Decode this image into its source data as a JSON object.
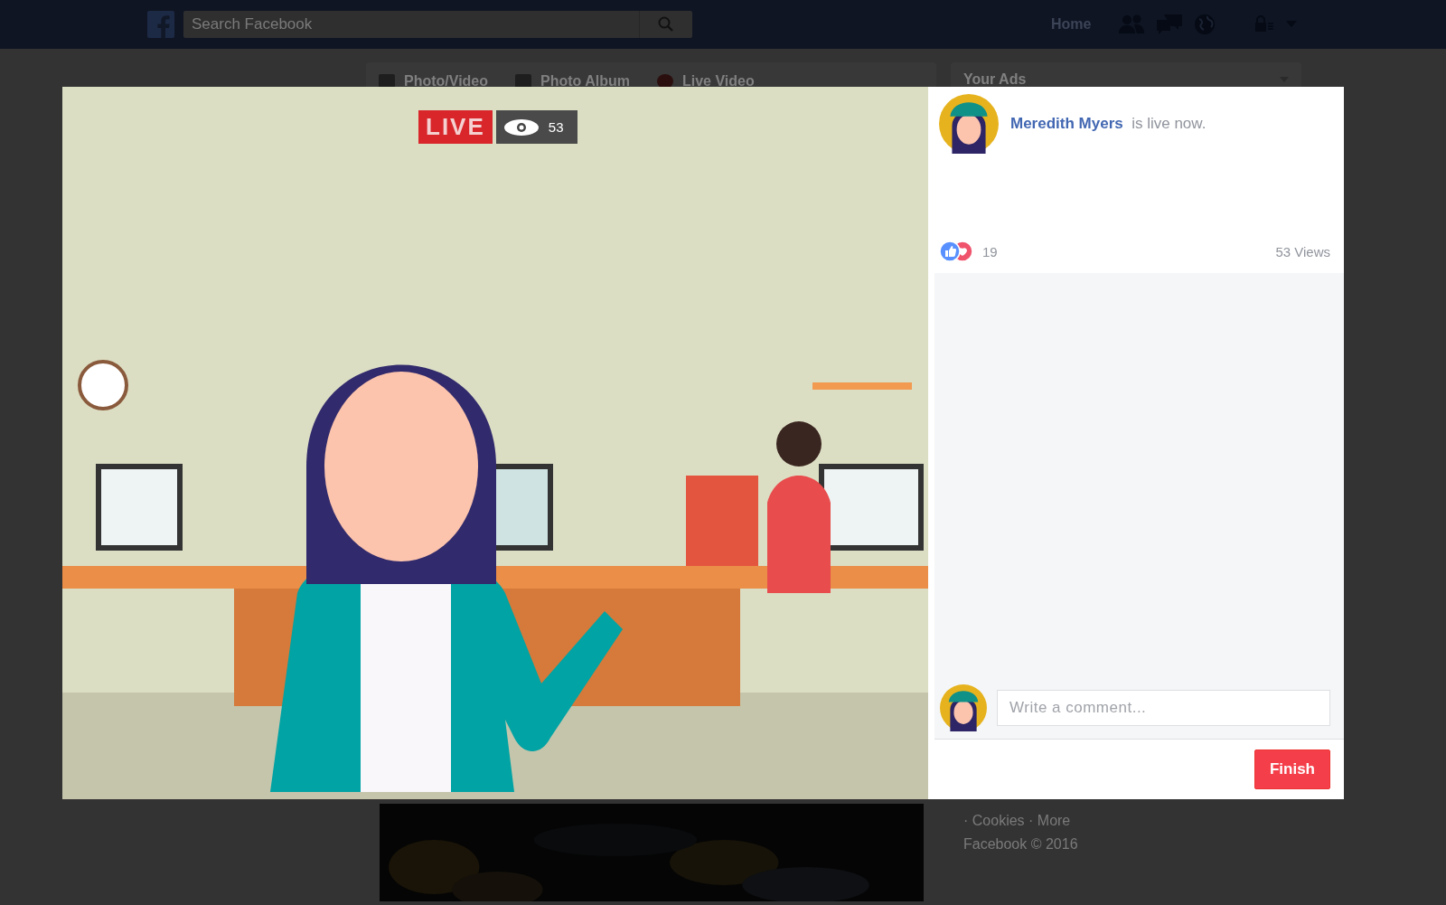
{
  "top_bar": {
    "search": {
      "placeholder": "Search Facebook"
    },
    "nav": [
      {
        "label": "Home"
      }
    ]
  },
  "composer": {
    "tabs": [
      {
        "label": "Photo/Video"
      },
      {
        "label": "Photo Album",
        "kind": "album"
      },
      {
        "label": "Live Video",
        "kind": "live"
      }
    ]
  },
  "ads": {
    "title": "Your Ads"
  },
  "footer": {
    "links": "· Cookies · More",
    "copyright": "Facebook © 2016"
  },
  "live_modal": {
    "badge": "LIVE",
    "viewers": "53",
    "host": {
      "name": "Meredith Myers",
      "status": "is live now."
    },
    "reactions": {
      "count": "19"
    },
    "views": "53 Views",
    "comment": {
      "placeholder": "Write a comment..."
    },
    "finish_button": "Finish"
  }
}
